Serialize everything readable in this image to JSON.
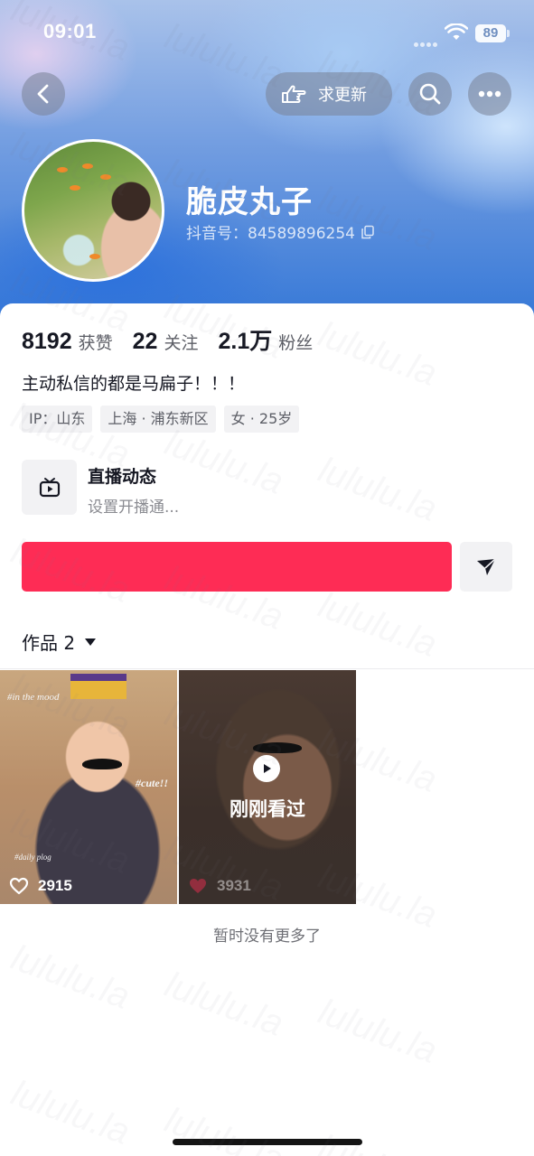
{
  "status_bar": {
    "time": "09:01",
    "battery": "89"
  },
  "header": {
    "update_button_label": "求更新"
  },
  "profile": {
    "nickname": "脆皮丸子",
    "douyin_id": "抖音号：84589896254"
  },
  "stats": [
    {
      "value": "8192",
      "label": "获赞"
    },
    {
      "value": "22",
      "label": "关注"
    },
    {
      "value": "2.1万",
      "label": "粉丝"
    }
  ],
  "bio": "主动私信的都是马扁子！！！",
  "tags": [
    "IP：山东",
    "上海 · 浦东新区",
    "女 · 25岁"
  ],
  "live": {
    "title": "直播动态",
    "subtitle": "设置开播通..."
  },
  "works": {
    "tab_label": "作品 2"
  },
  "videos": [
    {
      "likes": "2915",
      "stickers": [
        "#in the mood",
        "#cute!!",
        "#daily plog"
      ]
    },
    {
      "likes": "3931",
      "overlay": "刚刚看过"
    }
  ],
  "footer": {
    "no_more": "暂时没有更多了"
  },
  "watermark": "lululu.la",
  "colors": {
    "follow_button": "#fe2c55",
    "text_primary": "#161823",
    "text_secondary": "#5c5e66"
  }
}
